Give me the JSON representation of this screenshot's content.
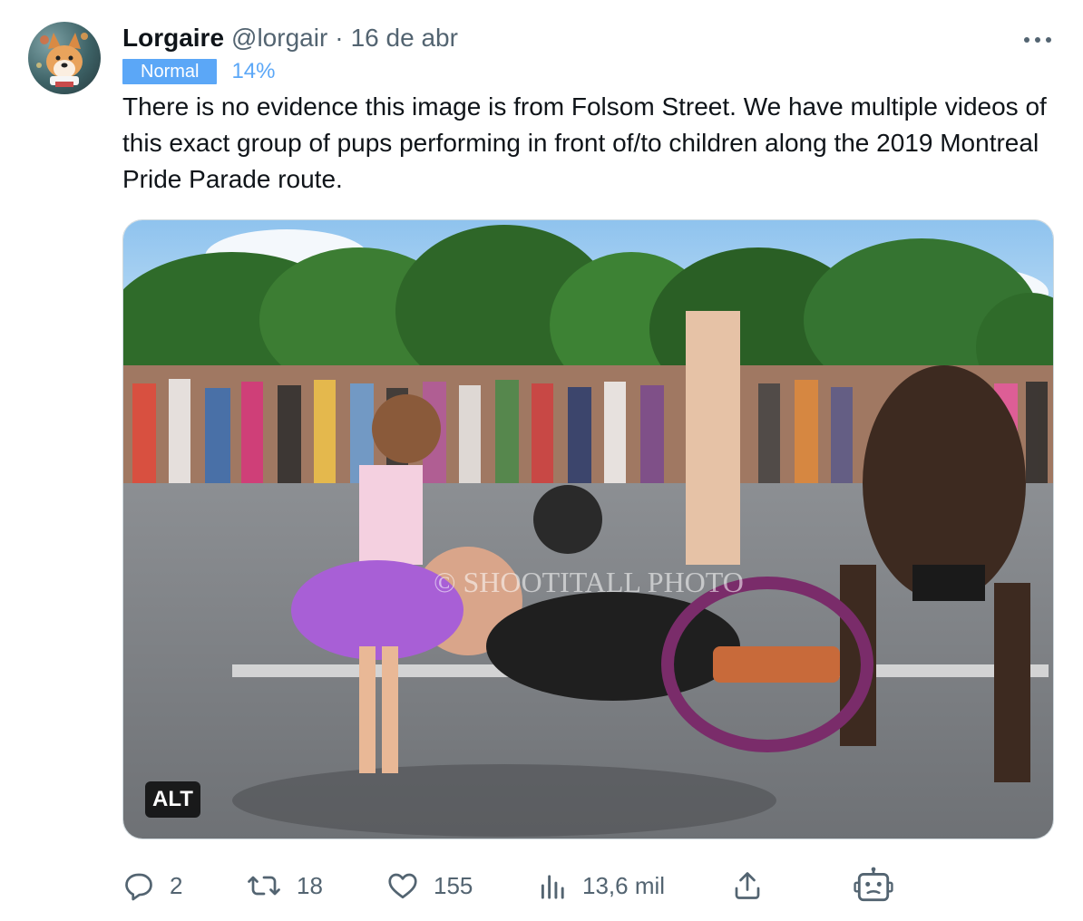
{
  "tweet": {
    "author_name": "Lorgaire",
    "handle": "@lorgair",
    "separator": "·",
    "date": "16 de abr",
    "badge_label": "Normal",
    "badge_percent": "14%",
    "text": "There is no evidence this image is from Folsom Street. We have multiple videos of this exact group of pups performing in front of/to children along the 2019 Montreal Pride Parade route.",
    "media": {
      "alt_label": "ALT",
      "watermark": "© SHOOTITALL PHOTO"
    }
  },
  "actions": {
    "replies": "2",
    "retweets": "18",
    "likes": "155",
    "views": "13,6 mil"
  },
  "icons": [
    "corgi-avatar",
    "more-icon",
    "reply-icon",
    "retweet-icon",
    "like-icon",
    "views-icon",
    "share-icon",
    "robot-icon"
  ],
  "colors": {
    "badge": "#5ba7f7",
    "secondary_text": "#536471",
    "primary_text": "#0f1419"
  }
}
